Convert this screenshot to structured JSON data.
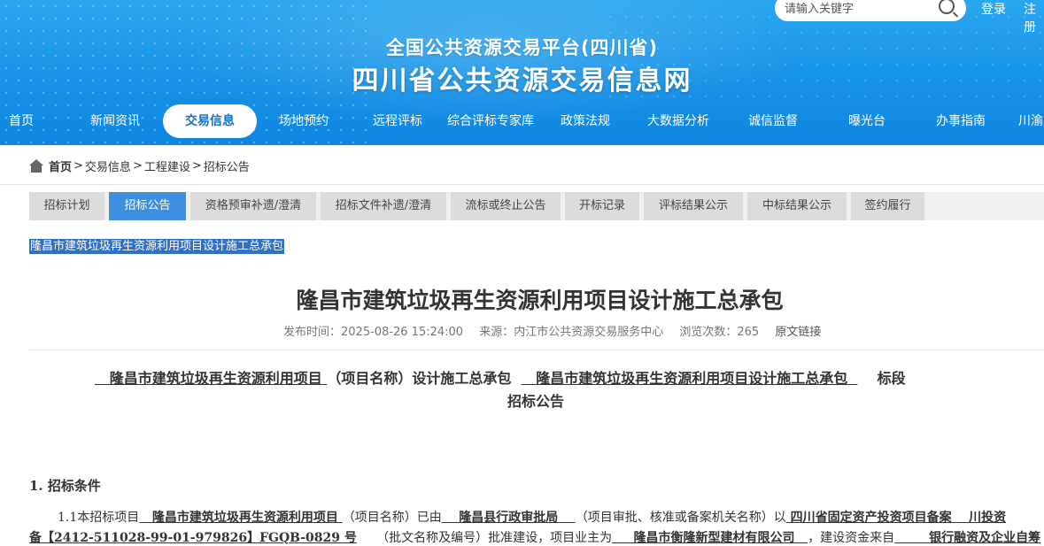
{
  "header": {
    "search_placeholder": "请输入关键字",
    "login": "登录",
    "register": "注册",
    "subtitle": "全国公共资源交易平台(四川省)",
    "title": "四川省公共资源交易信息网"
  },
  "nav": [
    "首页",
    "新闻资讯",
    "交易信息",
    "场地预约",
    "远程评标",
    "综合评标专家库",
    "政策法规",
    "大数据分析",
    "诚信监督",
    "曝光台",
    "办事指南",
    "川渝"
  ],
  "nav_active": "交易信息",
  "breadcrumb": {
    "home": "首页",
    "items": [
      "交易信息",
      "工程建设",
      "招标公告"
    ],
    "sep": ">"
  },
  "tabs": [
    "招标计划",
    "招标公告",
    "资格预审补遗/澄清",
    "招标文件补遗/澄清",
    "流标或终止公告",
    "开标记录",
    "评标结果公示",
    "中标结果公示",
    "签约履行"
  ],
  "tab_active": "招标公告",
  "selected_link": "隆昌市建筑垃圾再生资源利用项目设计施工总承包",
  "doc": {
    "title": "隆昌市建筑垃圾再生资源利用项目设计施工总承包",
    "meta": {
      "publish": "发布时间：2025-08-26 15:24:00",
      "source": "来源：内江市公共资源交易服务中心",
      "views": "浏览次数：265",
      "original": "原文链接"
    },
    "heading_a_blank": "隆昌市建筑垃圾再生资源利用项目",
    "heading_a_mid": "（项目名称）设计施工总承包",
    "heading_a_blank2": "隆昌市建筑垃圾再生资源利用项目设计施工总承包",
    "heading_a_end": "标段",
    "heading_b": "招标公告",
    "section1": "1.  招标条件",
    "p1": {
      "a": "1.1本招标项目",
      "b": "隆昌市建筑垃圾再生资源利用项目",
      "c": "（项目名称）已由",
      "d": "隆昌县行政审批局",
      "e": "（项目审批、核准或备案机关名称）以",
      "f": "四川省固定资产投资项目备案",
      "g": "川投资"
    },
    "p2": {
      "a": "备【2412-511028-99-01-979826】FGQB-0829 号",
      "b": "（批文名称及编号）批准建设，项目业主为",
      "c": "隆昌市衡隆新型建材有限公司",
      "d": "，建设资金来自",
      "e": "银行融资及企业自筹"
    }
  }
}
